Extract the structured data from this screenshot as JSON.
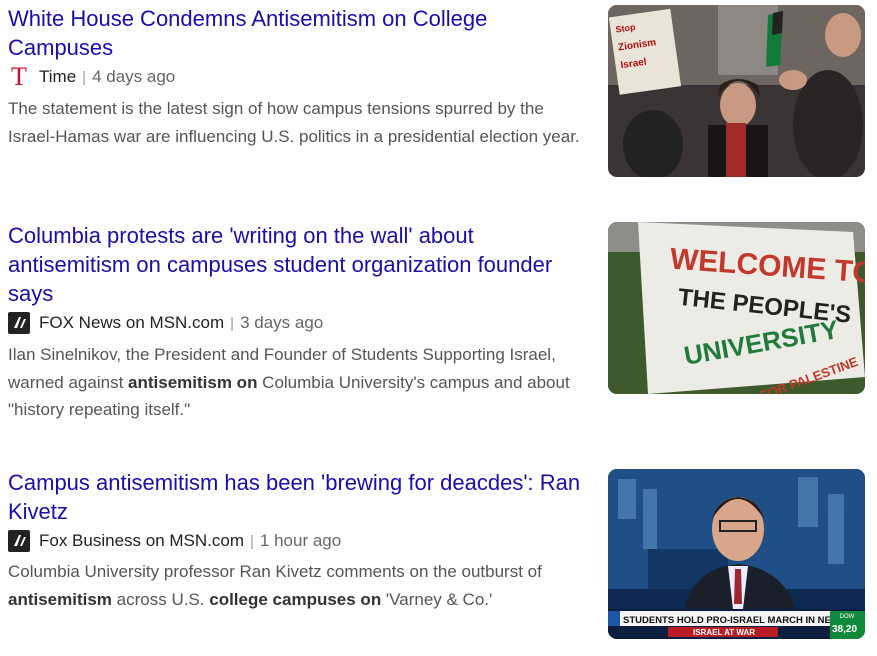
{
  "articles": [
    {
      "title": "White House Condemns Antisemitism on College Campuses",
      "source_icon": "time-logo-icon",
      "source_icon_text": "T",
      "source": "Time",
      "time": "4 days ago",
      "snippet": [
        {
          "text": "The statement is the latest sign of how campus tensions spurred by the Israel-Hamas war are influencing U.S. politics in a presidential election year.",
          "bold": false
        }
      ],
      "image_alt": "protest-crowd-photo",
      "image_text": [
        "Stop",
        "Zionism",
        "Israel"
      ]
    },
    {
      "title": "Columbia protests are 'writing on the wall' about antisemitism on campuses student organization founder says",
      "source_icon": "msn-publisher-icon",
      "source": "FOX News on MSN.com",
      "time": "3 days ago",
      "snippet": [
        {
          "text": "Ilan Sinelnikov, the President and Founder of Students Supporting Israel, warned against ",
          "bold": false
        },
        {
          "text": "antisemitism on",
          "bold": true
        },
        {
          "text": " Columbia University's campus and about \"history repeating itself.\"",
          "bold": false
        }
      ],
      "image_alt": "protest-banner-photo",
      "image_text": [
        "WELCOME TO",
        "THE PEOPLE'S",
        "UNIVERSITY",
        "FOR PALESTINE"
      ]
    },
    {
      "title": "Campus antisemitism has been 'brewing for deacdes': Ran Kivetz",
      "source_icon": "msn-publisher-icon",
      "source": "Fox Business on MSN.com",
      "time": "1 hour ago",
      "snippet": [
        {
          "text": "Columbia University professor Ran Kivetz comments on the outburst of ",
          "bold": false
        },
        {
          "text": "antisemitism",
          "bold": true
        },
        {
          "text": " across U.S. ",
          "bold": false
        },
        {
          "text": "college campuses on",
          "bold": true
        },
        {
          "text": " 'Varney & Co.'",
          "bold": false
        }
      ],
      "image_alt": "tv-interview-photo",
      "image_text": [
        "STUDENTS HOLD PRO-ISRAEL MARCH IN NEW YORK CITY",
        "ISRAEL AT WAR",
        "38,20",
        "DOW"
      ]
    }
  ],
  "separator": "|",
  "colors": {
    "title": "#1a0dab",
    "snippet": "#555555",
    "time_logo": "#c8102e"
  }
}
